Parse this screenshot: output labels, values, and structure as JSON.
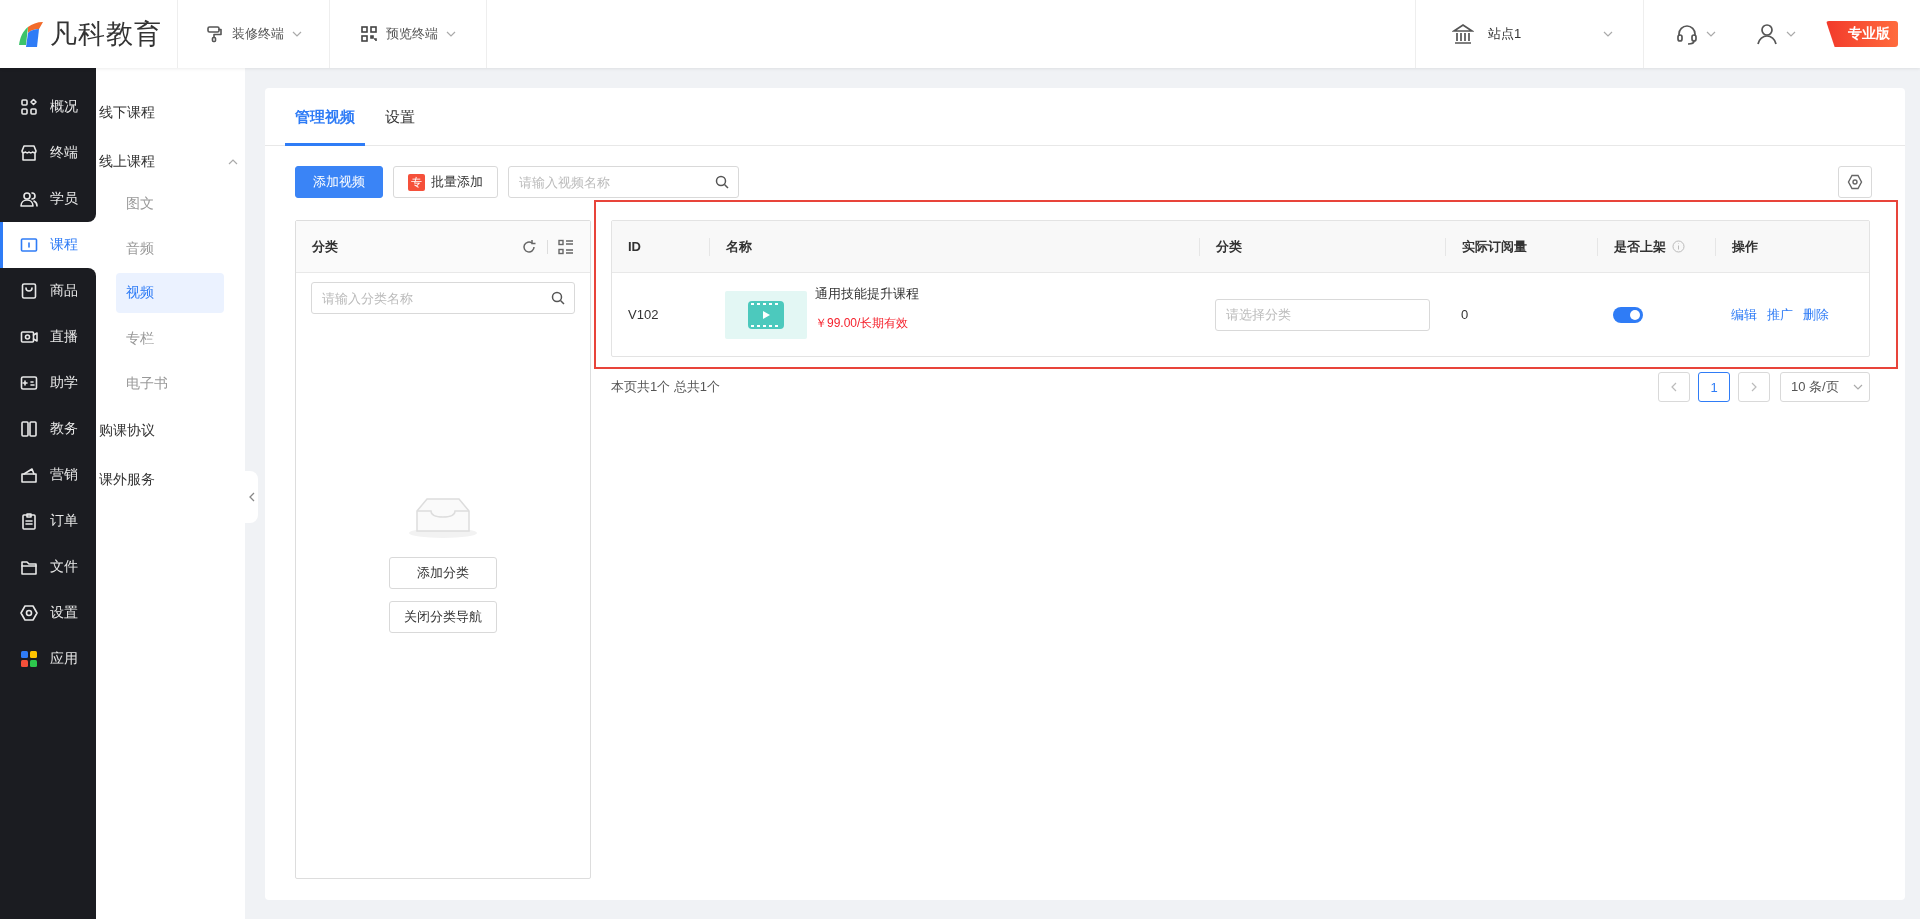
{
  "header": {
    "logo": "凡科教育",
    "nav": [
      {
        "label": "装修终端"
      },
      {
        "label": "预览终端"
      }
    ],
    "site": "站点1",
    "badge": "专业版"
  },
  "sidebar": {
    "items": [
      {
        "label": "概况",
        "selected": false
      },
      {
        "label": "终端",
        "selected": false
      },
      {
        "label": "学员",
        "selected": false
      },
      {
        "label": "课程",
        "selected": true
      },
      {
        "label": "商品",
        "selected": false
      },
      {
        "label": "直播",
        "selected": false
      },
      {
        "label": "助学",
        "selected": false
      },
      {
        "label": "教务",
        "selected": false
      },
      {
        "label": "营销",
        "selected": false
      },
      {
        "label": "订单",
        "selected": false
      },
      {
        "label": "文件",
        "selected": false
      },
      {
        "label": "设置",
        "selected": false
      },
      {
        "label": "应用",
        "selected": false
      }
    ]
  },
  "submenu": [
    {
      "label": "线下课程"
    },
    {
      "label": "线上课程",
      "expanded": true,
      "children": [
        {
          "label": "图文",
          "selected": false
        },
        {
          "label": "音频",
          "selected": false
        },
        {
          "label": "视频",
          "selected": true
        },
        {
          "label": "专栏",
          "selected": false
        },
        {
          "label": "电子书",
          "selected": false
        }
      ]
    },
    {
      "label": "购课协议"
    },
    {
      "label": "课外服务"
    }
  ],
  "tabs": [
    {
      "label": "管理视频",
      "selected": true
    },
    {
      "label": "设置",
      "selected": false
    }
  ],
  "toolbar": {
    "add_button": "添加视频",
    "batch_button": {
      "tag": "专",
      "label": "批量添加"
    },
    "search": {
      "placeholder": "请输入视频名称"
    }
  },
  "category_panel": {
    "title": "分类",
    "search": {
      "placeholder": "请输入分类名称"
    },
    "buttons": [
      "添加分类",
      "关闭分类导航"
    ]
  },
  "table": {
    "columns": [
      "ID",
      "名称",
      "分类",
      "实际订阅量",
      "是否上架",
      "操作"
    ],
    "rows": [
      {
        "id": "V102",
        "name": "通用技能提升课程",
        "price": "￥99.00/长期有效",
        "category": {
          "placeholder": "请选择分类"
        },
        "subscriptions": "0",
        "on_shelf": true,
        "actions": [
          "编辑",
          "推广",
          "删除"
        ]
      }
    ]
  },
  "pagination": {
    "summary": "本页共1个 总共1个",
    "pages": [
      {
        "label": "1",
        "selected": true
      }
    ],
    "page_size": "10 条/页"
  }
}
